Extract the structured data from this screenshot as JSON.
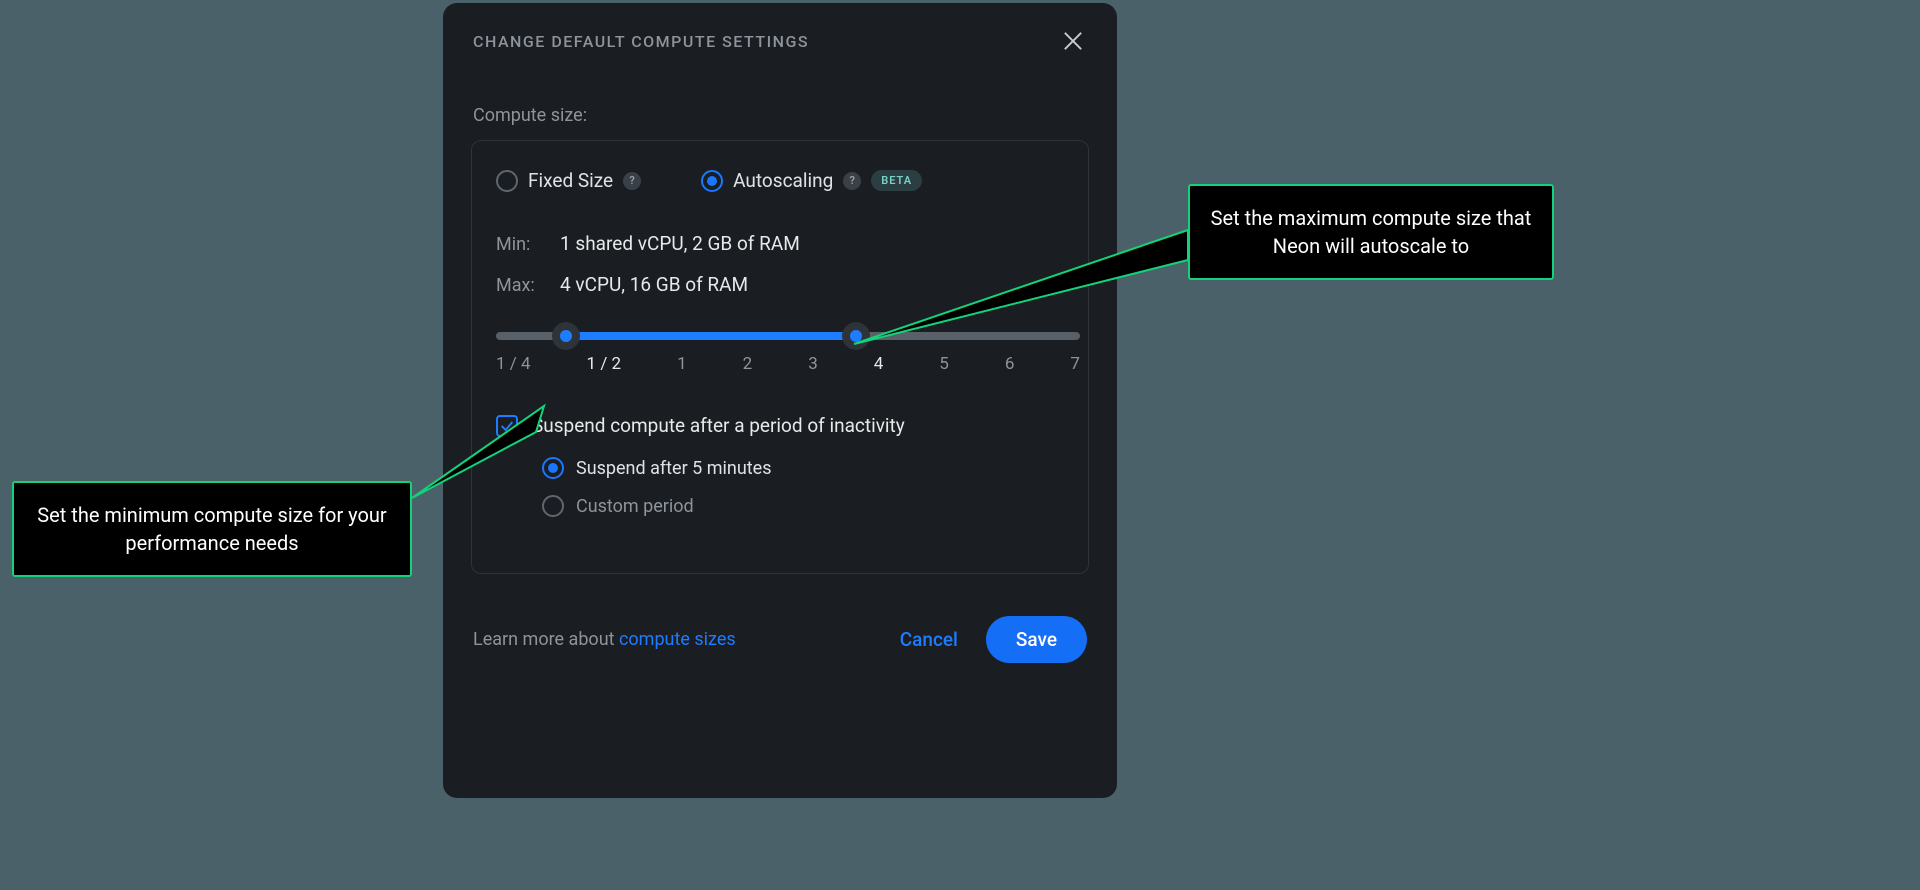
{
  "dialog": {
    "title": "CHANGE DEFAULT COMPUTE SETTINGS",
    "section_label": "Compute size:",
    "mode": {
      "fixed_label": "Fixed Size",
      "autoscaling_label": "Autoscaling",
      "beta_badge": "BETA",
      "selected": "autoscaling"
    },
    "specs": {
      "min_key": "Min:",
      "min_val": "1 shared vCPU, 2 GB of RAM",
      "max_key": "Max:",
      "max_val": "4 vCPU, 16 GB of RAM"
    },
    "slider": {
      "ticks": [
        "1 / 4",
        "1 / 2",
        "1",
        "2",
        "3",
        "4",
        "5",
        "6",
        "7"
      ],
      "min_index": 1,
      "max_index": 5
    },
    "suspend": {
      "checkbox_label": "Suspend compute after a period of inactivity",
      "checked": true,
      "option_default": "Suspend after 5 minutes",
      "option_custom": "Custom period",
      "selected": "default"
    },
    "footer": {
      "learn_prefix": "Learn more about ",
      "learn_link": "compute sizes",
      "cancel": "Cancel",
      "save": "Save"
    }
  },
  "callouts": {
    "min": "Set the minimum compute size for your performance needs",
    "max": "Set the maximum compute size that Neon will autoscale to"
  }
}
